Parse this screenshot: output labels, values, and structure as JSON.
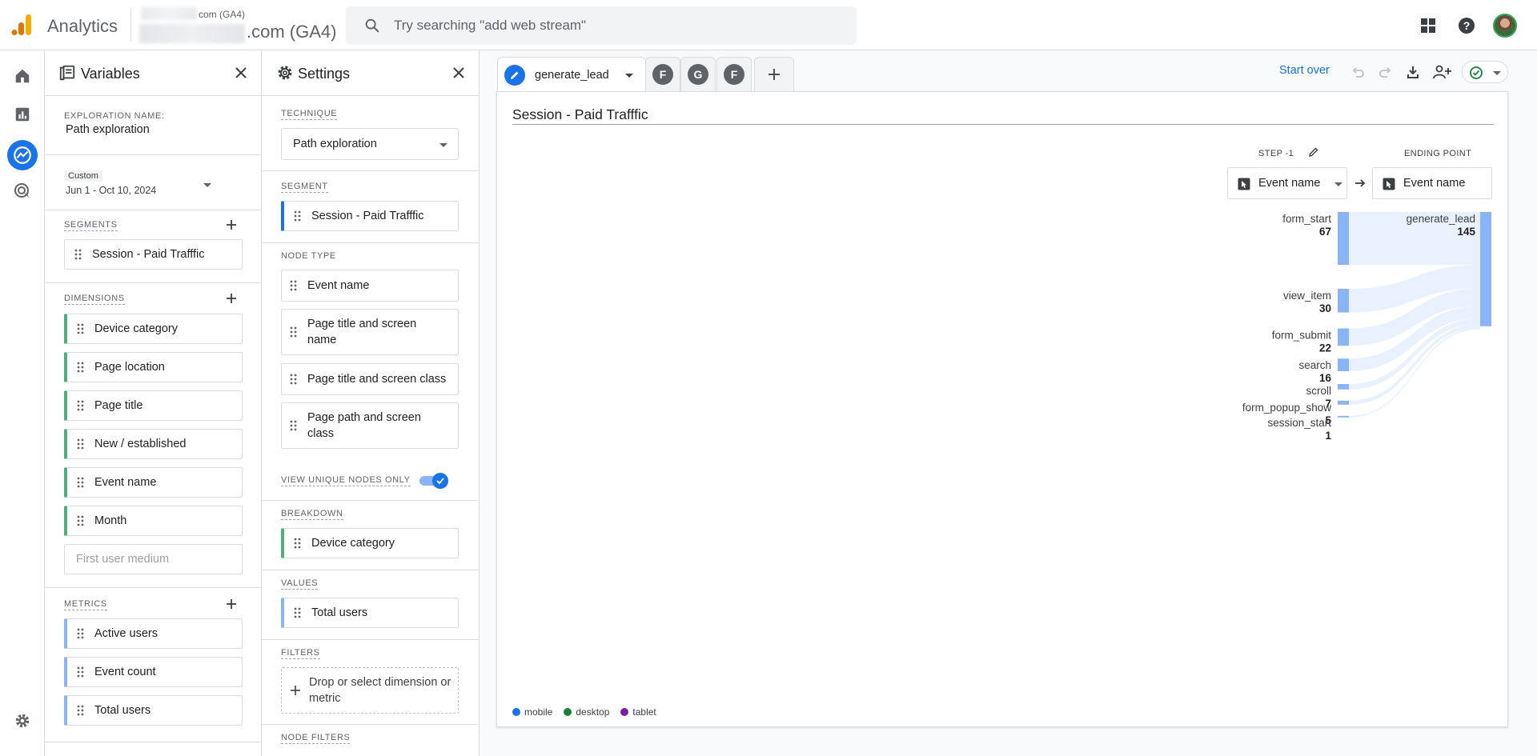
{
  "header": {
    "app_title": "Analytics",
    "account_name": "com (GA4)",
    "property_name": ".com (GA4)",
    "search_placeholder": "Try searching \"add web stream\""
  },
  "variables": {
    "title": "Variables",
    "exploration_name_label": "EXPLORATION NAME:",
    "exploration_name": "Path exploration",
    "date_range_label": "Custom",
    "date_range": "Jun 1 - Oct 10, 2024",
    "segments_label": "SEGMENTS",
    "segments": [
      "Session - Paid Trafffic"
    ],
    "dimensions_label": "DIMENSIONS",
    "dimensions": [
      "Device category",
      "Page location",
      "Page title",
      "New / established",
      "Event name",
      "Month"
    ],
    "dimension_placeholder": "First user medium",
    "metrics_label": "METRICS",
    "metrics": [
      "Active users",
      "Event count",
      "Total users"
    ]
  },
  "settings": {
    "title": "Settings",
    "technique_label": "TECHNIQUE",
    "technique": "Path exploration",
    "segment_label": "SEGMENT",
    "segment": "Session - Paid Trafffic",
    "node_type_label": "NODE TYPE",
    "node_types": [
      "Event name",
      "Page title and screen name",
      "Page title and screen class",
      "Page path and screen class"
    ],
    "unique_nodes_label": "VIEW UNIQUE NODES ONLY",
    "unique_nodes_on": true,
    "breakdown_label": "BREAKDOWN",
    "breakdown": "Device category",
    "values_label": "VALUES",
    "values": "Total users",
    "filters_label": "FILTERS",
    "filters_drop": "Drop or select dimension or metric",
    "node_filters_label": "NODE FILTERS"
  },
  "tabs": {
    "active": "generate_lead",
    "others": [
      "F",
      "G",
      "F"
    ]
  },
  "toolbar": {
    "start_over": "Start over"
  },
  "viz": {
    "title": "Session - Paid Trafffic",
    "step_label": "STEP -1",
    "ending_label": "ENDING POINT",
    "step_node": "Event name",
    "ending_node": "Event name",
    "step_nodes": [
      {
        "name": "form_start",
        "value": "67"
      },
      {
        "name": "view_item",
        "value": "30"
      },
      {
        "name": "form_submit",
        "value": "22"
      },
      {
        "name": "search",
        "value": "16"
      },
      {
        "name": "scroll",
        "value": "7"
      },
      {
        "name": "form_popup_show",
        "value": "5"
      },
      {
        "name": "session_start",
        "value": "1"
      }
    ],
    "ending_node_value": {
      "name": "generate_lead",
      "value": "145"
    },
    "legend": [
      {
        "label": "mobile",
        "color": "#1a73e8"
      },
      {
        "label": "desktop",
        "color": "#188038"
      },
      {
        "label": "tablet",
        "color": "#7b1fa2"
      }
    ],
    "bar_color": "#8ab4f8"
  }
}
